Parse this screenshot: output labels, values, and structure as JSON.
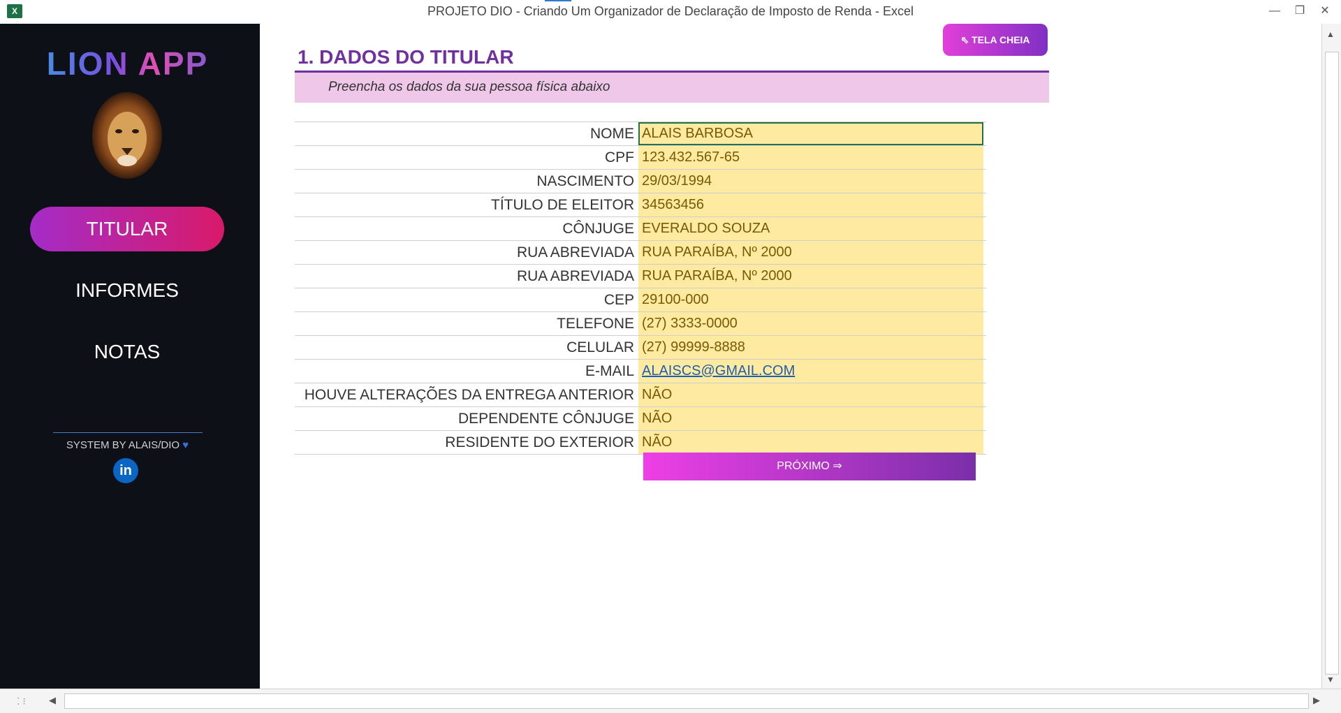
{
  "window": {
    "title": "PROJETO DIO - Criando Um Organizador de Declaração de Imposto de Renda - Excel",
    "app_icon": "X",
    "controls": {
      "minimize": "—",
      "restore": "❐",
      "close": "✕"
    }
  },
  "sidebar": {
    "logo": "LION APP",
    "nav": [
      {
        "label": "TITULAR",
        "active": true
      },
      {
        "label": "INFORMES",
        "active": false
      },
      {
        "label": "NOTAS",
        "active": false
      }
    ],
    "system_credit": "SYSTEM BY ALAIS/DIO",
    "heart": "♥",
    "linkedin": "in"
  },
  "main": {
    "fullscreen_button": "⇖ TELA CHEIA",
    "section_title": "1. DADOS DO TITULAR",
    "subtitle": "Preencha os dados da sua pessoa física abaixo",
    "fields": [
      {
        "label": "NOME",
        "value": "ALAIS BARBOSA"
      },
      {
        "label": "CPF",
        "value": "123.432.567-65"
      },
      {
        "label": "NASCIMENTO",
        "value": "29/03/1994"
      },
      {
        "label": "TÍTULO DE ELEITOR",
        "value": "34563456"
      },
      {
        "label": "CÔNJUGE",
        "value": "EVERALDO SOUZA"
      },
      {
        "label": "RUA ABREVIADA",
        "value": "RUA PARAÍBA, Nº 2000"
      },
      {
        "label": "RUA ABREVIADA",
        "value": "RUA PARAÍBA, Nº 2000"
      },
      {
        "label": "CEP",
        "value": "29100-000"
      },
      {
        "label": "TELEFONE",
        "value": "(27) 3333-0000"
      },
      {
        "label": "CELULAR",
        "value": "(27) 99999-8888"
      },
      {
        "label": "E-MAIL",
        "value": "ALAISCS@GMAIL.COM"
      },
      {
        "label": "HOUVE ALTERAÇÕES DA ENTREGA ANTERIOR",
        "value": "NÃO"
      },
      {
        "label": "DEPENDENTE CÔNJUGE",
        "value": "NÃO"
      },
      {
        "label": "RESIDENTE DO EXTERIOR",
        "value": "NÃO"
      }
    ],
    "next_button": "PRÓXIMO ⇒"
  },
  "scrollbars": {
    "up": "▲",
    "down": "▼",
    "left": "◀",
    "right": "▶",
    "grip": "⁚ ⁝"
  },
  "colors": {
    "sidebar_bg": "#0d1117",
    "accent_purple": "#7030a0",
    "input_fill": "#feeaa0",
    "subtitle_band": "#efc8e9"
  }
}
